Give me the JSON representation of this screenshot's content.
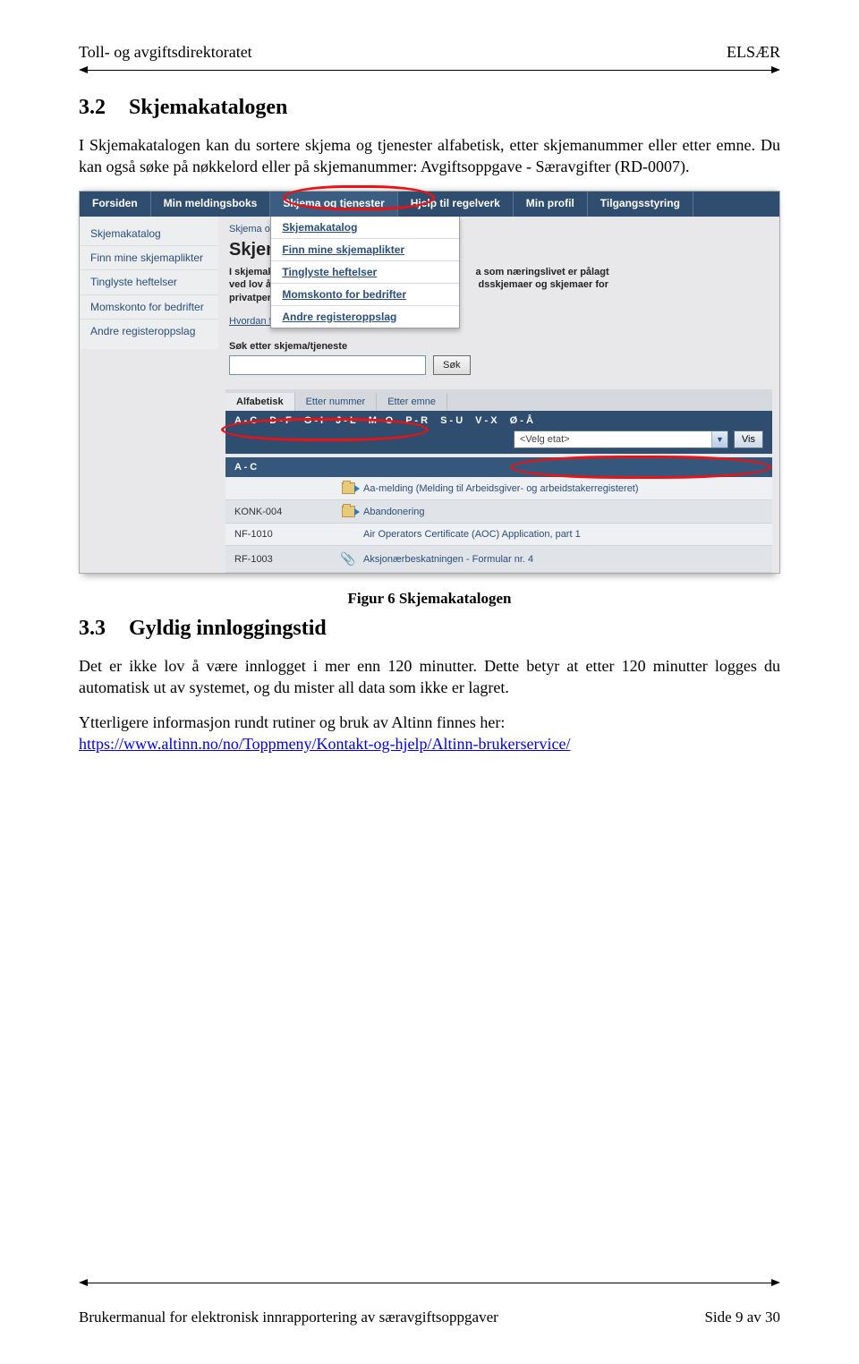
{
  "header": {
    "left": "Toll- og avgiftsdirektoratet",
    "right": "ELSÆR"
  },
  "section32": {
    "num": "3.2",
    "title": "Skjemakatalogen",
    "p1": "I Skjemakatalogen kan du sortere skjema og tjenester alfabetisk, etter skjemanummer eller etter emne. Du kan også søke på nøkkelord eller på skjemanummer: Avgiftsoppgave - Særavgifter (RD-0007)."
  },
  "shot": {
    "nav": [
      "Forsiden",
      "Min meldingsboks",
      "Skjema og tjenester",
      "Hjelp til regelverk",
      "Min profil",
      "Tilgangsstyring"
    ],
    "dropdown": [
      "Skjemakatalog",
      "Finn mine skjemaplikter",
      "Tinglyste heftelser",
      "Momskonto for bedrifter",
      "Andre registeroppslag"
    ],
    "sidebar": [
      "Skjemakatalog",
      "Finn mine skjemaplikter",
      "Tinglyste heftelser",
      "Momskonto for bedrifter",
      "Andre registeroppslag"
    ],
    "breadcrumb": "Skjema og t",
    "title": "Skjema",
    "para_a": "I skjemakat",
    "para_b": "a som næringslivet er pålagt",
    "para_c": "ved lov å se",
    "para_d": "dsskjemaer og skjemaer for",
    "para_e": "privatpersoner.",
    "find_link": "Hvordan finner jeg rett skjema",
    "search_label": "Søk etter skjema/tjeneste",
    "search_button": "Søk",
    "tabs": [
      "Alfabetisk",
      "Etter nummer",
      "Etter emne"
    ],
    "letters": [
      "A - C",
      "D - F",
      "G - I",
      "J - L",
      "M - O",
      "P - R",
      "S - U",
      "V - X",
      "Ø - Å"
    ],
    "select_placeholder": "<Velg etat>",
    "vis": "Vis",
    "group": "A - C",
    "rows": [
      {
        "code": "",
        "icon": "folder",
        "desc": "Aa-melding (Melding til Arbeidsgiver- og arbeidstakerregisteret)"
      },
      {
        "code": "KONK-004",
        "icon": "folder",
        "desc": "Abandonering"
      },
      {
        "code": "NF-1010",
        "icon": "",
        "desc": "Air Operators Certificate (AOC) Application, part 1"
      },
      {
        "code": "RF-1003",
        "icon": "clip",
        "desc": "Aksjonærbeskatningen - Formular nr. 4"
      }
    ]
  },
  "figcaption": "Figur 6 Skjemakatalogen",
  "section33": {
    "num": "3.3",
    "title": "Gyldig innloggingstid",
    "p1": "Det er ikke lov å være innlogget i mer enn 120 minutter. Dette betyr at etter 120 minutter logges du automatisk ut av systemet, og du mister all data som ikke er lagret.",
    "p2": "Ytterligere informasjon rundt rutiner og bruk av Altinn finnes her:",
    "link": "https://www.altinn.no/no/Toppmeny/Kontakt-og-hjelp/Altinn-brukerservice/"
  },
  "footer": {
    "left": "Brukermanual for elektronisk innrapportering av særavgiftsoppgaver",
    "right": "Side 9 av 30"
  }
}
